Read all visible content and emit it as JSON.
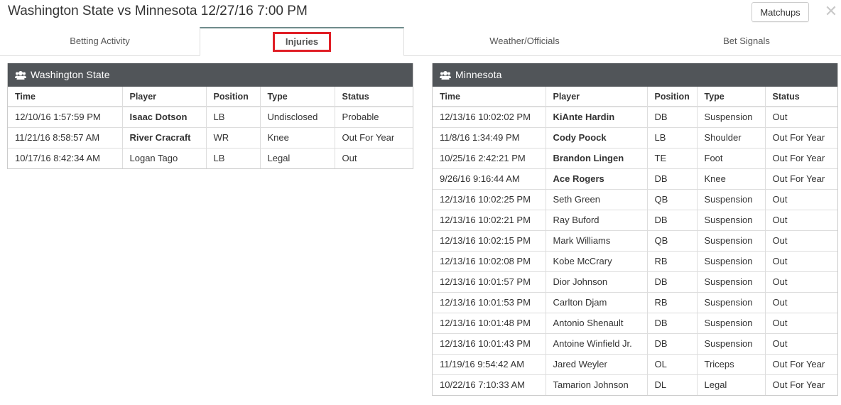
{
  "header": {
    "title": "Washington State vs Minnesota 12/27/16 7:00 PM",
    "matchups_label": "Matchups",
    "close_label": "✕"
  },
  "tabs": [
    {
      "label": "Betting Activity",
      "active": false
    },
    {
      "label": "Injuries",
      "active": true,
      "highlighted": true,
      "highlight_color": "#e01f26"
    },
    {
      "label": "Weather/Officials",
      "active": false
    },
    {
      "label": "Bet Signals",
      "active": false
    }
  ],
  "columns": [
    "Time",
    "Player",
    "Position",
    "Type",
    "Status"
  ],
  "panels": [
    {
      "team": "Washington State",
      "icon": "users-icon",
      "header_color": "#515559",
      "rows": [
        {
          "time": "12/10/16 1:57:59 PM",
          "player": "Isaac Dotson",
          "bold": true,
          "position": "LB",
          "type": "Undisclosed",
          "status": "Probable"
        },
        {
          "time": "11/21/16 8:58:57 AM",
          "player": "River Cracraft",
          "bold": true,
          "position": "WR",
          "type": "Knee",
          "status": "Out For Year"
        },
        {
          "time": "10/17/16 8:42:34 AM",
          "player": "Logan Tago",
          "bold": false,
          "position": "LB",
          "type": "Legal",
          "status": "Out"
        }
      ]
    },
    {
      "team": "Minnesota",
      "icon": "users-icon",
      "header_color": "#515559",
      "rows": [
        {
          "time": "12/13/16 10:02:02 PM",
          "player": "KiAnte Hardin",
          "bold": true,
          "position": "DB",
          "type": "Suspension",
          "status": "Out"
        },
        {
          "time": "11/8/16 1:34:49 PM",
          "player": "Cody Poock",
          "bold": true,
          "position": "LB",
          "type": "Shoulder",
          "status": "Out For Year"
        },
        {
          "time": "10/25/16 2:42:21 PM",
          "player": "Brandon Lingen",
          "bold": true,
          "position": "TE",
          "type": "Foot",
          "status": "Out For Year"
        },
        {
          "time": "9/26/16 9:16:44 AM",
          "player": "Ace Rogers",
          "bold": true,
          "position": "DB",
          "type": "Knee",
          "status": "Out For Year"
        },
        {
          "time": "12/13/16 10:02:25 PM",
          "player": "Seth Green",
          "bold": false,
          "position": "QB",
          "type": "Suspension",
          "status": "Out"
        },
        {
          "time": "12/13/16 10:02:21 PM",
          "player": "Ray Buford",
          "bold": false,
          "position": "DB",
          "type": "Suspension",
          "status": "Out"
        },
        {
          "time": "12/13/16 10:02:15 PM",
          "player": "Mark Williams",
          "bold": false,
          "position": "QB",
          "type": "Suspension",
          "status": "Out"
        },
        {
          "time": "12/13/16 10:02:08 PM",
          "player": "Kobe McCrary",
          "bold": false,
          "position": "RB",
          "type": "Suspension",
          "status": "Out"
        },
        {
          "time": "12/13/16 10:01:57 PM",
          "player": "Dior Johnson",
          "bold": false,
          "position": "DB",
          "type": "Suspension",
          "status": "Out"
        },
        {
          "time": "12/13/16 10:01:53 PM",
          "player": "Carlton Djam",
          "bold": false,
          "position": "RB",
          "type": "Suspension",
          "status": "Out"
        },
        {
          "time": "12/13/16 10:01:48 PM",
          "player": "Antonio Shenault",
          "bold": false,
          "position": "DB",
          "type": "Suspension",
          "status": "Out"
        },
        {
          "time": "12/13/16 10:01:43 PM",
          "player": "Antoine Winfield Jr.",
          "bold": false,
          "position": "DB",
          "type": "Suspension",
          "status": "Out"
        },
        {
          "time": "11/19/16 9:54:42 AM",
          "player": "Jared Weyler",
          "bold": false,
          "position": "OL",
          "type": "Triceps",
          "status": "Out For Year"
        },
        {
          "time": "10/22/16 7:10:33 AM",
          "player": "Tamarion Johnson",
          "bold": false,
          "position": "DL",
          "type": "Legal",
          "status": "Out For Year"
        }
      ]
    }
  ]
}
